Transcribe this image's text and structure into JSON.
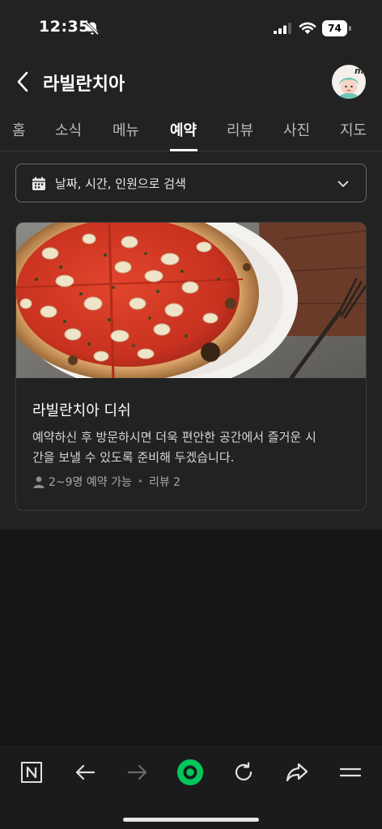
{
  "status_bar": {
    "time": "12:35",
    "battery": "74",
    "icons": [
      "bell-off-icon",
      "signal-icon",
      "wifi-icon",
      "battery-icon"
    ]
  },
  "header": {
    "title": "라빌란치아",
    "back_icon": "chevron-left-icon",
    "avatar_badge": "my"
  },
  "tabs": [
    {
      "label": "홈",
      "active": false
    },
    {
      "label": "소식",
      "active": false
    },
    {
      "label": "메뉴",
      "active": false
    },
    {
      "label": "예약",
      "active": true
    },
    {
      "label": "리뷰",
      "active": false
    },
    {
      "label": "사진",
      "active": false
    },
    {
      "label": "지도",
      "active": false
    }
  ],
  "search": {
    "label": "날짜, 시간, 인원으로 검색",
    "icon": "calendar-icon"
  },
  "card": {
    "title": "라빌란치아 디쉬",
    "description_line1": "예약하신 후 방문하시면 더욱 편안한 공간에서 즐거운 시",
    "description_line2": "간을 보낼 수 있도록 준비해 두겠습니다.",
    "capacity": "2~9명 예약 가능",
    "reviews": "리뷰 2"
  },
  "bottom_nav": {
    "items": [
      "naver-n-icon",
      "back-arrow-icon",
      "forward-arrow-icon",
      "green-dot-icon",
      "refresh-icon",
      "share-icon",
      "menu-icon"
    ]
  },
  "colors": {
    "background": "#222222",
    "accent_green": "#03c75a",
    "text": "#ffffff"
  }
}
